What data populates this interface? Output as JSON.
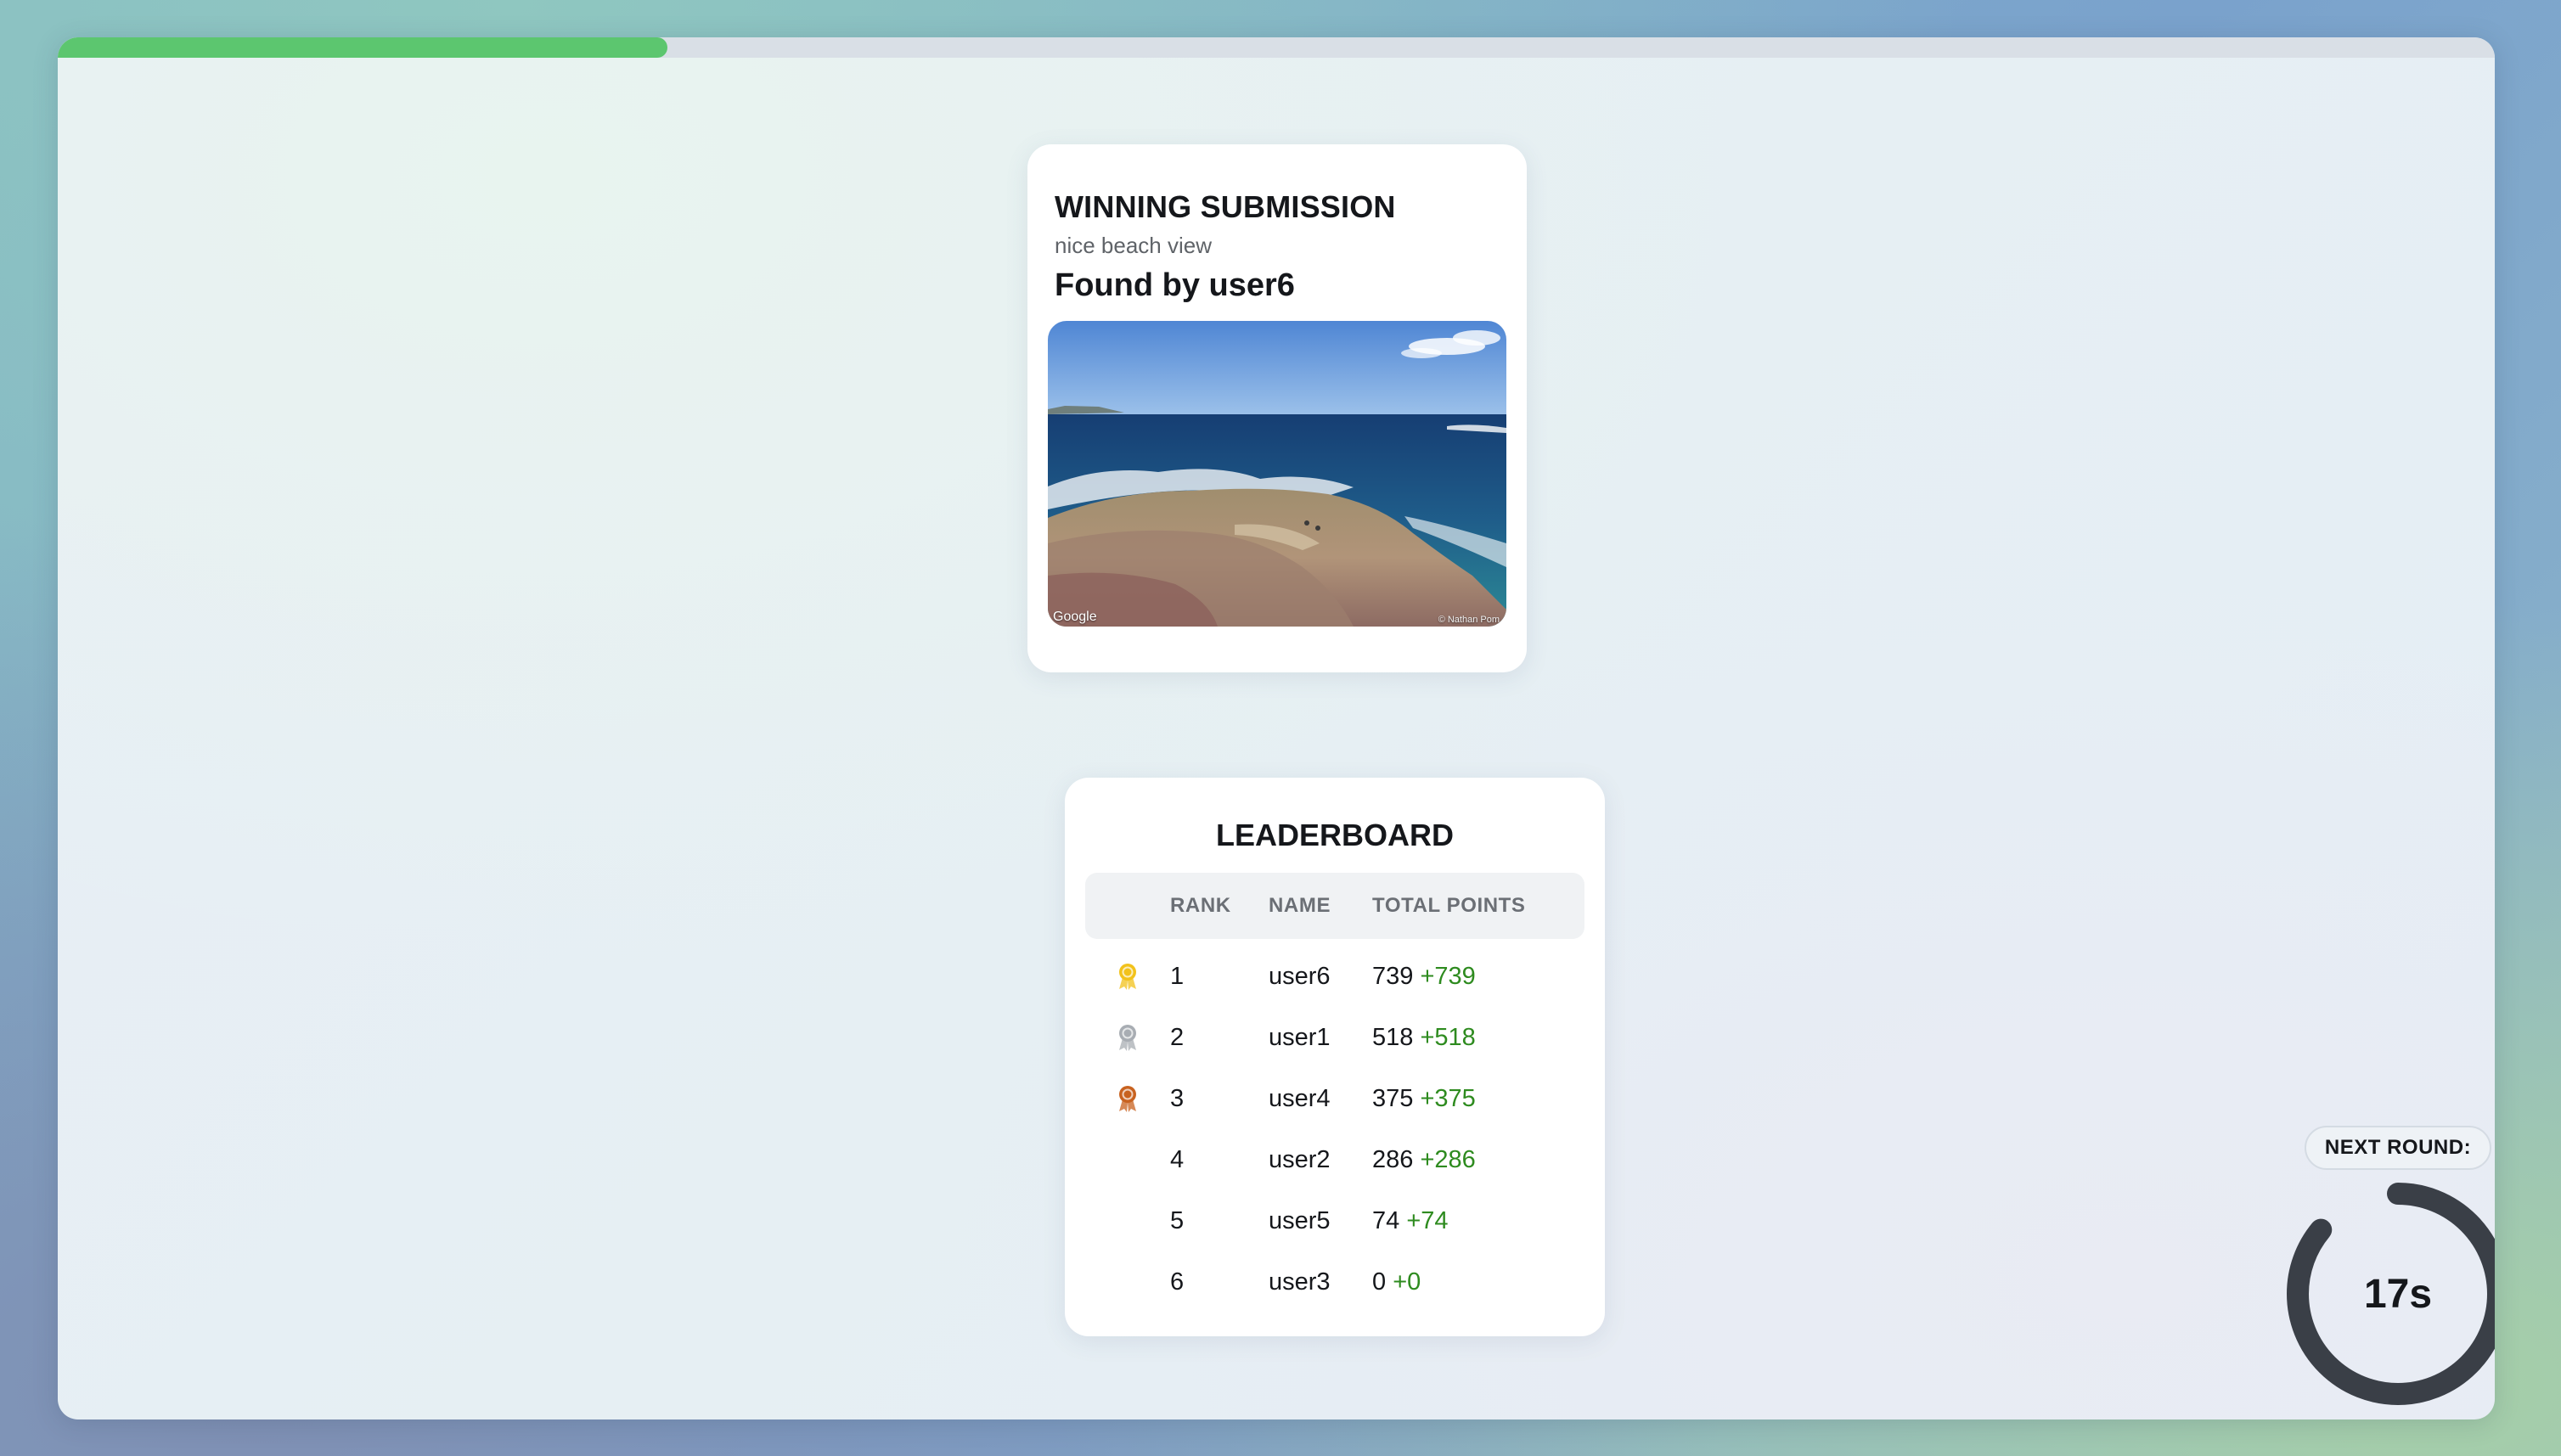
{
  "round_progress": 0.25,
  "winning": {
    "title": "WINNING SUBMISSION",
    "caption": "nice beach view",
    "found_by": "Found by user6",
    "image": {
      "description_icon": "beach-photo",
      "credit_left": "Google",
      "credit_right": "© Nathan Pom"
    }
  },
  "leaderboard": {
    "title": "LEADERBOARD",
    "columns": {
      "rank": "RANK",
      "name": "NAME",
      "points": "TOTAL POINTS"
    },
    "rows": [
      {
        "medal": "gold-medal-icon",
        "rank": "1",
        "name": "user6",
        "points": "739",
        "gain": "+739"
      },
      {
        "medal": "silver-medal-icon",
        "rank": "2",
        "name": "user1",
        "points": "518",
        "gain": "+518"
      },
      {
        "medal": "bronze-medal-icon",
        "rank": "3",
        "name": "user4",
        "points": "375",
        "gain": "+375"
      },
      {
        "medal": "",
        "rank": "4",
        "name": "user2",
        "points": "286",
        "gain": "+286"
      },
      {
        "medal": "",
        "rank": "5",
        "name": "user5",
        "points": "74",
        "gain": "+74"
      },
      {
        "medal": "",
        "rank": "6",
        "name": "user3",
        "points": "0",
        "gain": "+0"
      }
    ]
  },
  "next_round": {
    "label": "NEXT ROUND:",
    "countdown": "17s",
    "remaining_fraction": 0.86
  },
  "colors": {
    "progress": "#5cc66f",
    "gain": "#2e8b1f",
    "timer_ring": "#3a3f47",
    "gold": "#f2c21b",
    "silver": "#a8adb3",
    "bronze": "#c8621f"
  }
}
